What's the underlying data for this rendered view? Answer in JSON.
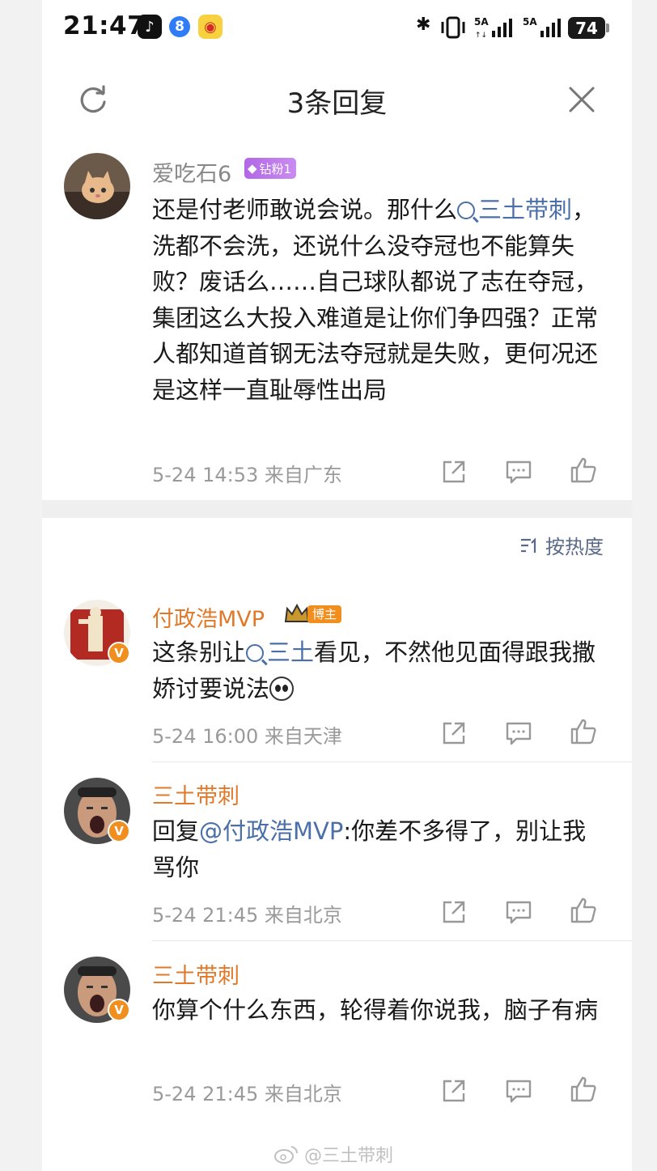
{
  "status_bar": {
    "time": "21:47",
    "network_1": "5A",
    "network_2": "5A",
    "battery": "74"
  },
  "header": {
    "title": "3条回复"
  },
  "main_comment": {
    "username": "爱吃石6",
    "badge": "钻粉1",
    "text_before_link": "还是付老师敢说会说。那什么",
    "link": "三土带刺",
    "text_after_link": "，洗都不会洗，还说什么没夺冠也不能算失败？废话么……自己球队都说了志在夺冠，集团这么大投入难道是让你们争四强？正常人都知道首钢无法夺冠就是失败，更何况还是这样一直耻辱性出局",
    "meta": "5-24 14:53 来自广东"
  },
  "sort": {
    "label": "按热度"
  },
  "replies": [
    {
      "username": "付政浩MVP",
      "tag": "博主",
      "text_before_link": "这条别让",
      "link": "三土",
      "text_after_link": "看见，不然他见面得跟我撒娇讨要说法",
      "meta": "5-24 16:00 来自天津"
    },
    {
      "username": "三土带刺",
      "reply_prefix": "回复",
      "mention": "@付政浩MVP",
      "text": ":你差不多得了，别让我骂你",
      "meta": "5-24 21:45 来自北京"
    },
    {
      "username": "三土带刺",
      "text": "你算个什么东西，轮得着你说我，脑子有病",
      "meta": "5-24 21:45 来自北京"
    }
  ],
  "watermark": "@三土带刺",
  "colors": {
    "link": "#4b6fa8",
    "orange_name": "#e07a2a",
    "verified": "#f08e1e",
    "fan_badge": "#b267e6"
  },
  "icons": [
    "refresh-icon",
    "close-icon",
    "share-icon",
    "comment-icon",
    "like-icon",
    "verified-icon",
    "crown-icon",
    "sort-icon",
    "weibo-icon"
  ]
}
